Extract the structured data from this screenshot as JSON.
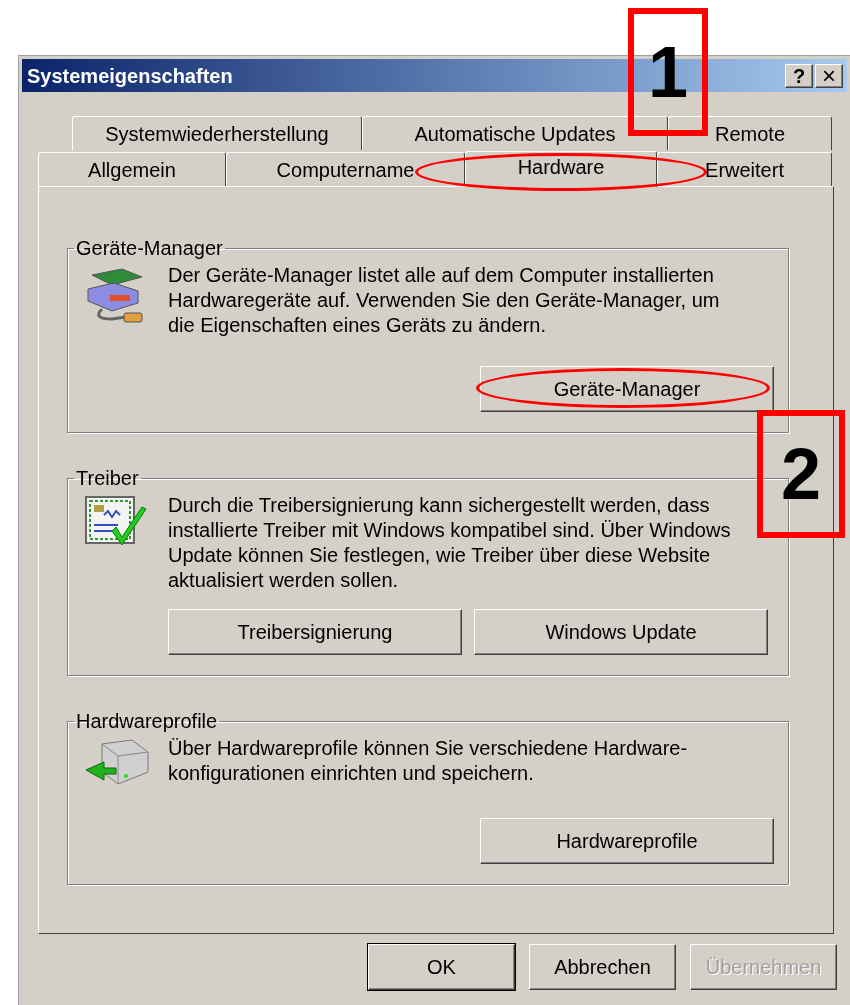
{
  "window": {
    "title": "Systemeigenschaften",
    "controls": [
      {
        "kind": "help",
        "label": "?"
      },
      {
        "kind": "close",
        "label": "×"
      }
    ]
  },
  "tab_rows": [
    [
      {
        "label": "Systemwiederherstellung",
        "selected": false,
        "highlighted": false
      },
      {
        "label": "Automatische Updates",
        "selected": false,
        "highlighted": false
      },
      {
        "label": "Remote",
        "selected": false,
        "highlighted": false
      }
    ],
    [
      {
        "label": "Allgemein",
        "selected": false,
        "highlighted": false
      },
      {
        "label": "Computername",
        "selected": false,
        "highlighted": false
      },
      {
        "label": "Hardware",
        "selected": true,
        "highlighted": true
      },
      {
        "label": "Erweitert",
        "selected": false,
        "highlighted": false
      }
    ]
  ],
  "groups": [
    {
      "kind": "device_manager",
      "title": "Geräte-Manager",
      "text": "Der Geräte-Manager listet alle auf dem Computer installierten Hardwaregeräte auf. Verwenden Sie den Geräte-Manager, um die Eigenschaften eines Geräts zu ändern.",
      "buttons": [
        {
          "label": "Geräte-Manager",
          "highlighted": true
        }
      ]
    },
    {
      "kind": "drivers",
      "title": "Treiber",
      "text": "Durch die Treibersignierung kann sichergestellt werden, dass installierte Treiber mit Windows kompatibel sind. Über Windows Update können Sie festlegen, wie Treiber über diese Website aktualisiert werden sollen.",
      "buttons": [
        {
          "label": "Treibersignierung",
          "highlighted": false
        },
        {
          "label": "Windows Update",
          "highlighted": false
        }
      ]
    },
    {
      "kind": "profiles",
      "title": "Hardwareprofile",
      "text": "Über Hardwareprofile können Sie verschiedene Hardware-konfigurationen einrichten und speichern.",
      "buttons": [
        {
          "label": "Hardwareprofile",
          "highlighted": false
        }
      ]
    }
  ],
  "footer_buttons": [
    {
      "label": "OK",
      "default": true,
      "disabled": false
    },
    {
      "label": "Abbrechen",
      "default": false,
      "disabled": false
    },
    {
      "label": "Übernehmen",
      "default": false,
      "disabled": true
    }
  ],
  "annotations": [
    {
      "label": "1"
    },
    {
      "label": "2"
    }
  ]
}
